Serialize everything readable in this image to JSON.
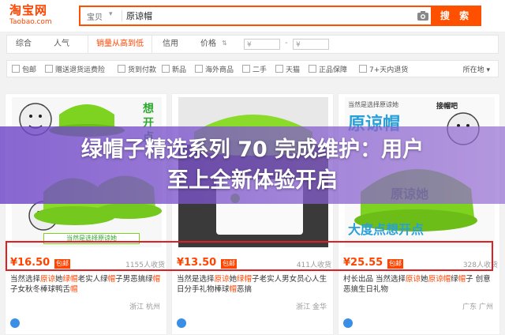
{
  "header": {
    "logo_main": "淘宝网",
    "logo_sub": "Taobao.com",
    "search_scope": "宝贝",
    "search_value": "原谅帽",
    "search_button": "搜 索",
    "camera_icon": "camera-icon"
  },
  "sort": {
    "items": [
      "综合",
      "人气",
      "销量从高到低",
      "信用",
      "价格"
    ],
    "price_from": "¥",
    "price_to": "¥",
    "price_dash": "-"
  },
  "filters": {
    "items": [
      "包邮",
      "赠送退货运费险",
      "货到付款",
      "新品",
      "海外商品",
      "二手",
      "天猫",
      "正品保障",
      "7+天内退货"
    ],
    "location": "所在地"
  },
  "products": [
    {
      "image_caption": "想开点",
      "image_badge": "当然是选择原谅她",
      "price": "¥16.50",
      "badge": "包邮",
      "sold": "1155人收货",
      "title_pre": "当然选择",
      "title_hl1": "原谅",
      "title_mid1": "她",
      "title_hl2": "绿帽",
      "title_mid2": "老实人绿",
      "title_hl3": "帽",
      "title_mid3": "子男恶搞",
      "title_line2_pre": "绿",
      "title_hl4": "帽",
      "title_line2_mid": "子女秋冬棒球鸭舌",
      "title_hl5": "帽",
      "location": "浙江 杭州"
    },
    {
      "price": "¥13.50",
      "badge": "包邮",
      "sold": "411人收货",
      "title_pre": "当然是选择",
      "title_hl1": "原谅",
      "title_mid1": "她",
      "title_hl2": "绿帽",
      "title_mid2": "子老实人男女员心人",
      "title_line2": "生日分手礼物棒球",
      "title_hl3": "帽",
      "title_line2_end": "恶搞",
      "location": "浙江 金华"
    },
    {
      "image_top": "当然是选择原谅她",
      "image_big": "原谅帽",
      "image_label1": "接帽吧",
      "image_label2": "大度点想开点",
      "price": "¥25.55",
      "badge": "包邮",
      "sold": "328人收货",
      "title_pre": "村长出品 当然选择",
      "title_hl1": "原谅",
      "title_mid1": "她",
      "title_hl2": "原谅帽",
      "title_mid2": "绿",
      "title_hl3": "帽",
      "title_mid3": "子 创",
      "title_line2": "意恶搞生日礼物",
      "location": "广东 广州"
    }
  ],
  "banner": {
    "line1": "绿帽子精选系列 70 完成维护：用户",
    "line2": "至上全新体验开启"
  },
  "colors": {
    "accent": "#ff4400",
    "hat_green": "#7ed321",
    "banner": "#7a4fd0"
  }
}
